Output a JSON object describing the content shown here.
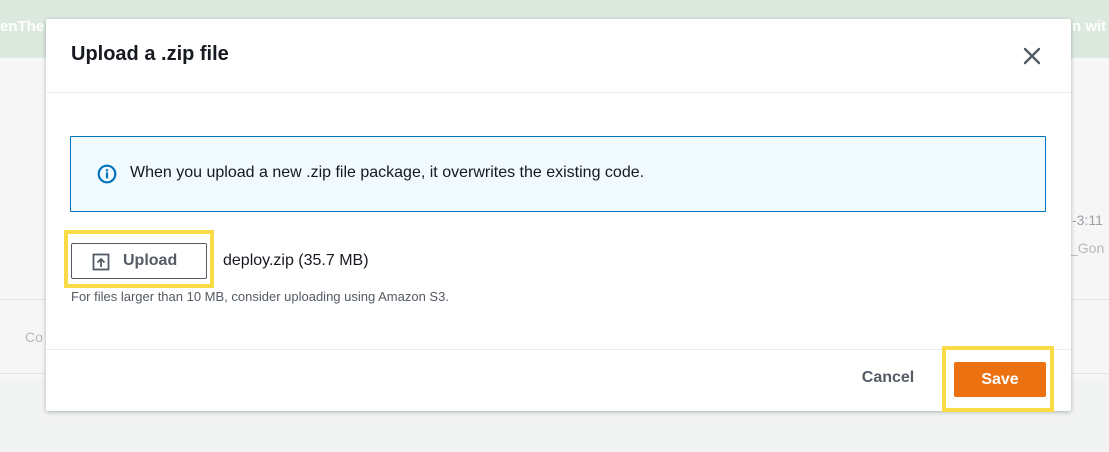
{
  "background": {
    "banner_left_text": "enThe",
    "banner_right_text": "n wit",
    "side_text_a": "-3:11",
    "side_text_b": "_Gon",
    "side_text_c": "Co"
  },
  "modal": {
    "title": "Upload a .zip file",
    "close_icon": "close-icon",
    "info": {
      "icon": "info-icon",
      "text": "When you upload a new .zip file package, it overwrites the existing code."
    },
    "upload": {
      "icon": "upload-icon",
      "label": "Upload",
      "filename": "deploy.zip (35.7 MB)",
      "hint": "For files larger than 10 MB, consider uploading using Amazon S3."
    },
    "footer": {
      "cancel_label": "Cancel",
      "save_label": "Save"
    }
  },
  "colors": {
    "accent_orange": "#ec7211",
    "info_blue": "#0073bb",
    "highlight_yellow": "#f9da47"
  }
}
